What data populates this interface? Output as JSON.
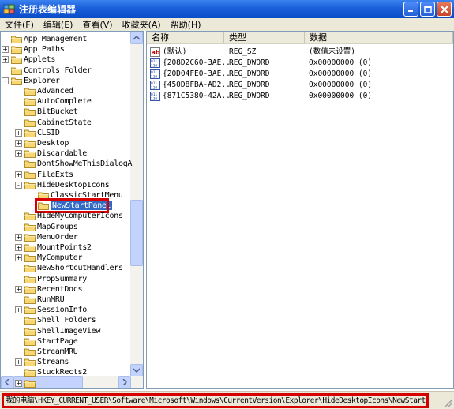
{
  "window": {
    "title": "注册表编辑器"
  },
  "menu": [
    "文件(F)",
    "编辑(E)",
    "查看(V)",
    "收藏夹(A)",
    "帮助(H)"
  ],
  "tree": {
    "items": [
      {
        "label": "App Management",
        "level": 1,
        "expander": "none"
      },
      {
        "label": "App Paths",
        "level": 1,
        "expander": "+"
      },
      {
        "label": "Applets",
        "level": 1,
        "expander": "+"
      },
      {
        "label": "Controls Folder",
        "level": 1,
        "expander": "none"
      },
      {
        "label": "Explorer",
        "level": 1,
        "expander": "-"
      },
      {
        "label": "Advanced",
        "level": 2,
        "expander": "none"
      },
      {
        "label": "AutoComplete",
        "level": 2,
        "expander": "none"
      },
      {
        "label": "BitBucket",
        "level": 2,
        "expander": "none"
      },
      {
        "label": "CabinetState",
        "level": 2,
        "expander": "none"
      },
      {
        "label": "CLSID",
        "level": 2,
        "expander": "+"
      },
      {
        "label": "Desktop",
        "level": 2,
        "expander": "+"
      },
      {
        "label": "Discardable",
        "level": 2,
        "expander": "+"
      },
      {
        "label": "DontShowMeThisDialogA",
        "level": 2,
        "expander": "none"
      },
      {
        "label": "FileExts",
        "level": 2,
        "expander": "+"
      },
      {
        "label": "HideDesktopIcons",
        "level": 2,
        "expander": "-"
      },
      {
        "label": "ClassicStartMenu",
        "level": 3,
        "expander": "none"
      },
      {
        "label": "NewStartPanel",
        "level": 3,
        "expander": "none",
        "selected": true
      },
      {
        "label": "HideMyComputerIcons",
        "level": 2,
        "expander": "none"
      },
      {
        "label": "MapGroups",
        "level": 2,
        "expander": "none"
      },
      {
        "label": "MenuOrder",
        "level": 2,
        "expander": "+"
      },
      {
        "label": "MountPoints2",
        "level": 2,
        "expander": "+"
      },
      {
        "label": "MyComputer",
        "level": 2,
        "expander": "+"
      },
      {
        "label": "NewShortcutHandlers",
        "level": 2,
        "expander": "none"
      },
      {
        "label": "PropSummary",
        "level": 2,
        "expander": "none"
      },
      {
        "label": "RecentDocs",
        "level": 2,
        "expander": "+"
      },
      {
        "label": "RunMRU",
        "level": 2,
        "expander": "none"
      },
      {
        "label": "SessionInfo",
        "level": 2,
        "expander": "+"
      },
      {
        "label": "Shell Folders",
        "level": 2,
        "expander": "none"
      },
      {
        "label": "ShellImageView",
        "level": 2,
        "expander": "none"
      },
      {
        "label": "StartPage",
        "level": 2,
        "expander": "none"
      },
      {
        "label": "StreamMRU",
        "level": 2,
        "expander": "none"
      },
      {
        "label": "Streams",
        "level": 2,
        "expander": "+"
      },
      {
        "label": "StuckRects2",
        "level": 2,
        "expander": "none"
      },
      {
        "label": "",
        "level": 2,
        "expander": "+"
      }
    ]
  },
  "values": {
    "columns": [
      "名称",
      "类型",
      "数据"
    ],
    "rows": [
      {
        "icon": "string-value-icon",
        "name": "(默认)",
        "type": "REG_SZ",
        "data": "(数值未设置)"
      },
      {
        "icon": "binary-value-icon",
        "name": "{208D2C60-3AE...",
        "type": "REG_DWORD",
        "data": "0x00000000  (0)"
      },
      {
        "icon": "binary-value-icon",
        "name": "{20D04FE0-3AE...",
        "type": "REG_DWORD",
        "data": "0x00000000  (0)"
      },
      {
        "icon": "binary-value-icon",
        "name": "{450D8FBA-AD2...",
        "type": "REG_DWORD",
        "data": "0x00000000  (0)"
      },
      {
        "icon": "binary-value-icon",
        "name": "{871C5380-42A...",
        "type": "REG_DWORD",
        "data": "0x00000000  (0)"
      }
    ]
  },
  "status": {
    "path": "我的电脑\\HKEY_CURRENT_USER\\Software\\Microsoft\\Windows\\CurrentVersion\\Explorer\\HideDesktopIcons\\NewStartPanel"
  },
  "colors": {
    "titlebar": "#0a4cc8",
    "selection": "#316ac5",
    "highlight_box": "#d60000",
    "chrome": "#ece9d8"
  }
}
